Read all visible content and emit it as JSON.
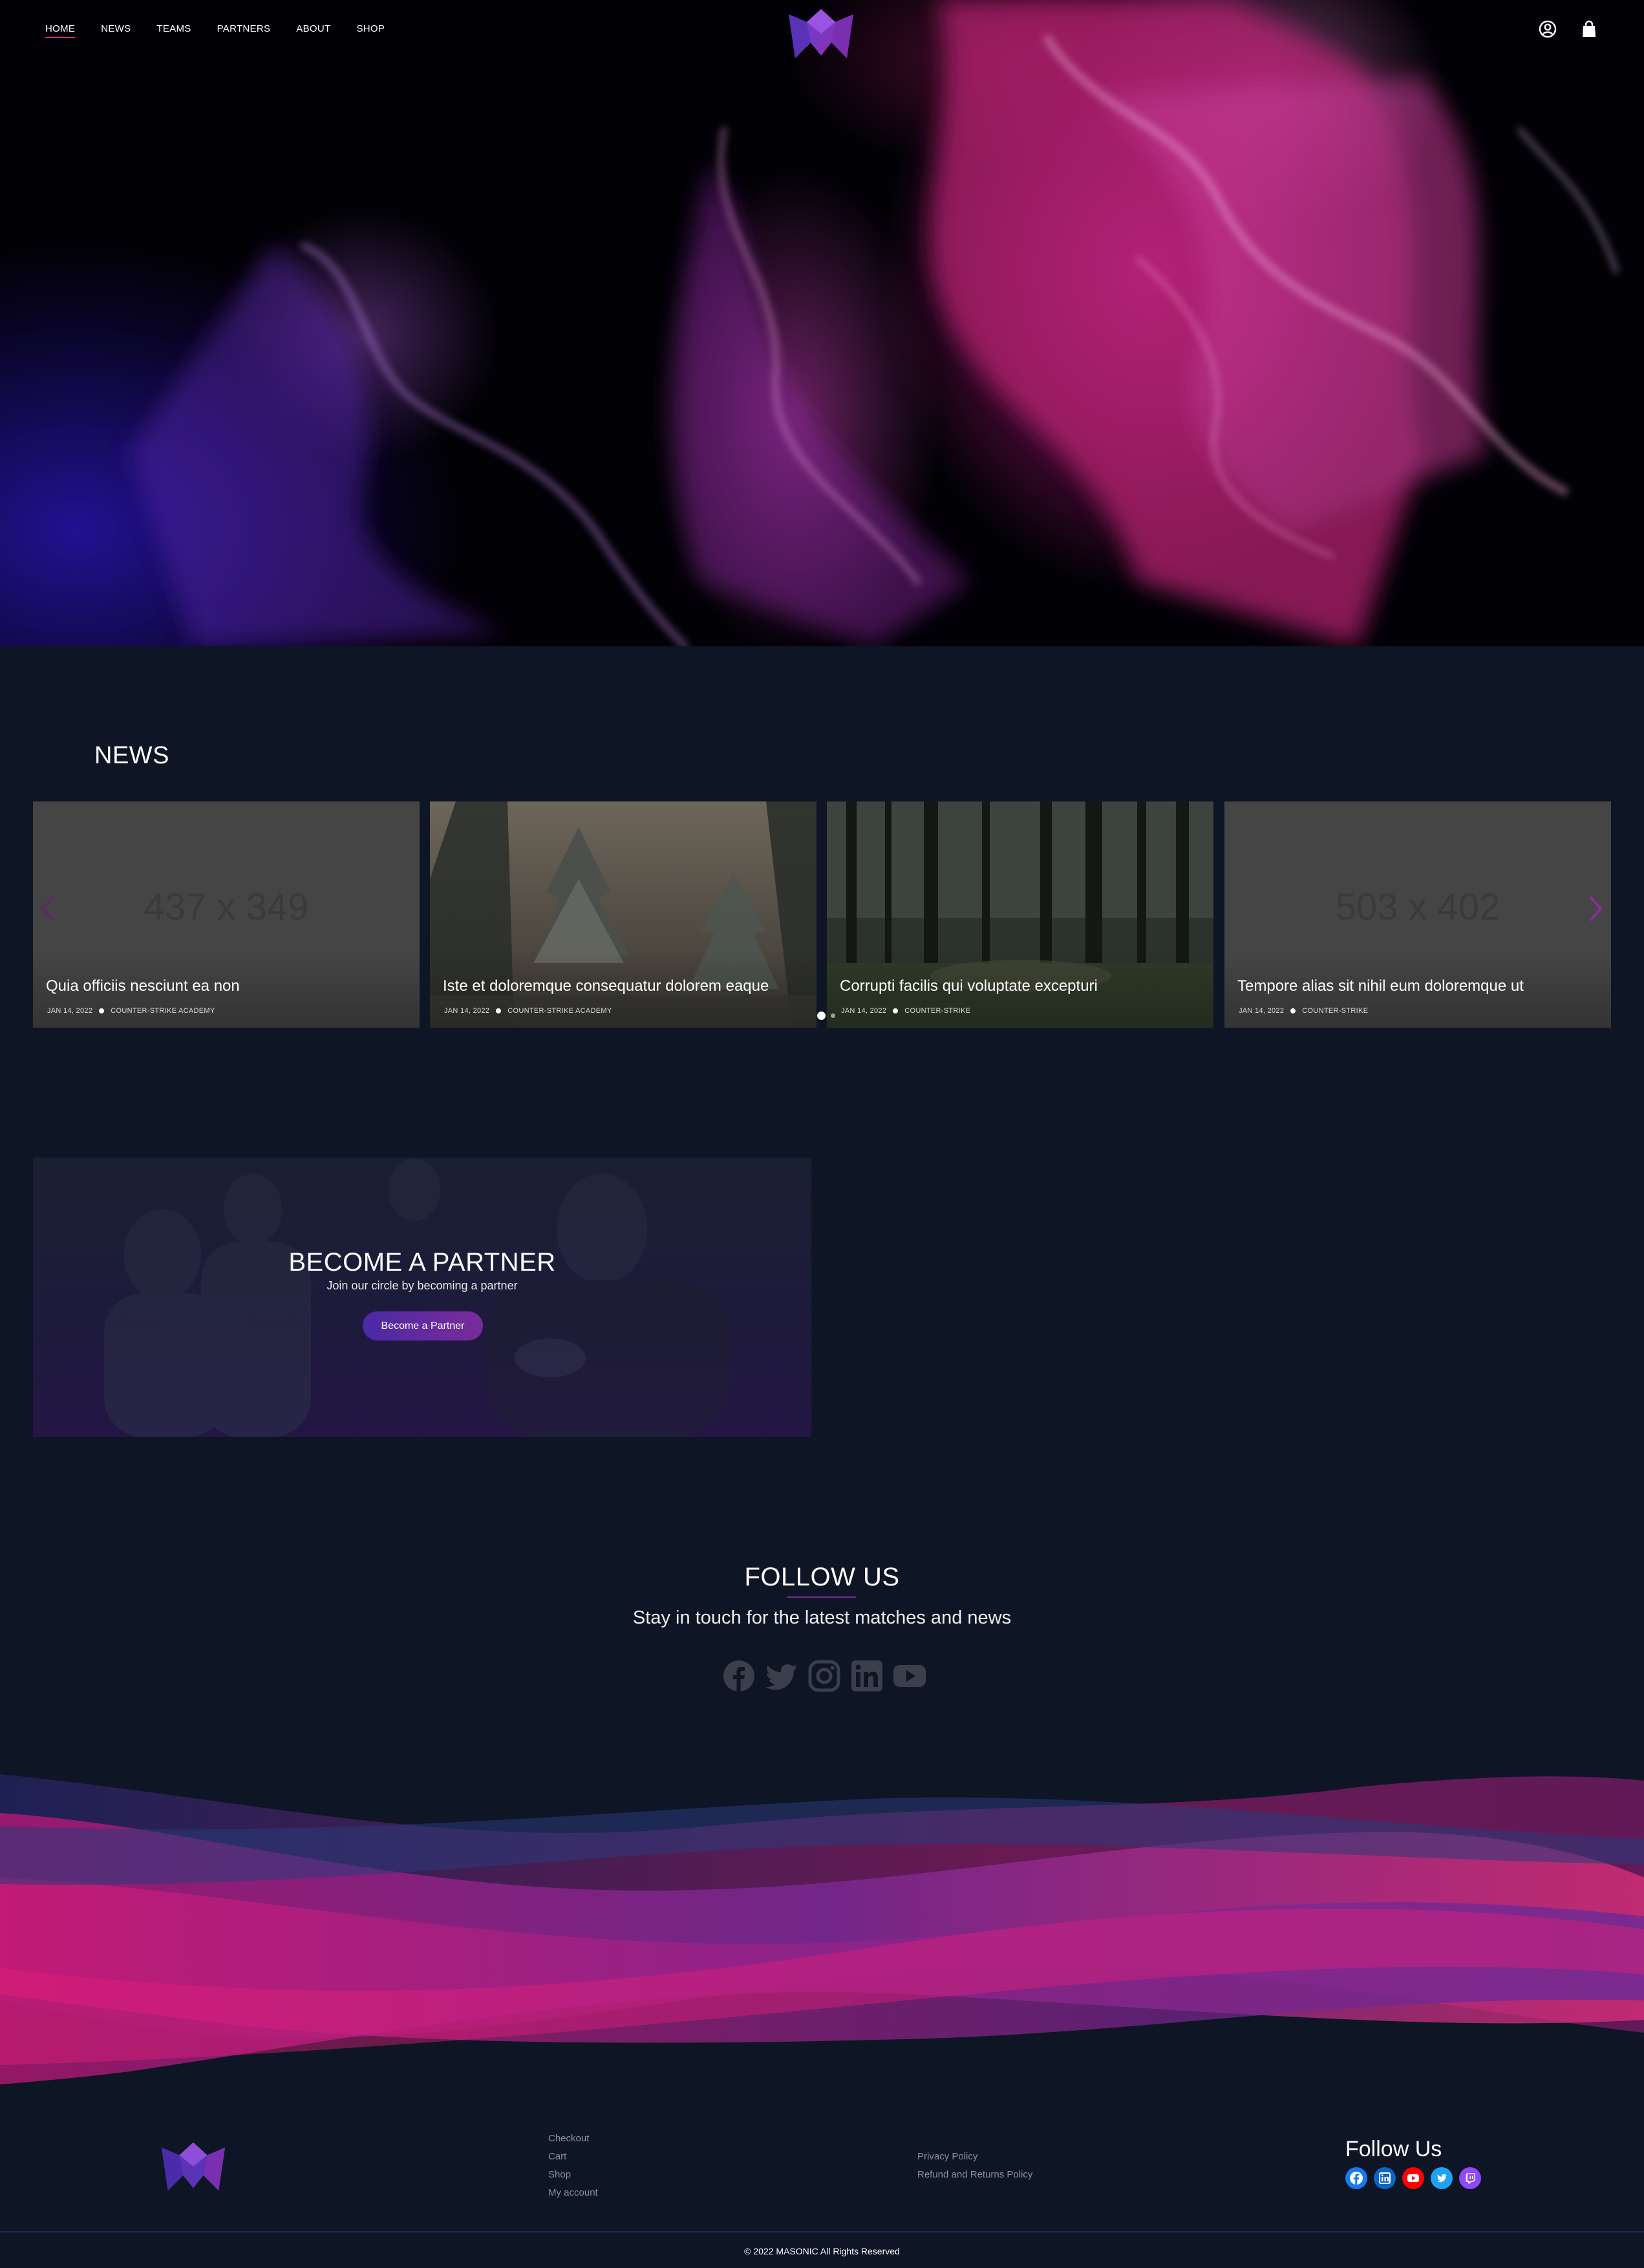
{
  "nav": {
    "items": [
      {
        "label": "HOME",
        "active": true
      },
      {
        "label": "NEWS"
      },
      {
        "label": "TEAMS"
      },
      {
        "label": "PARTNERS"
      },
      {
        "label": "ABOUT"
      },
      {
        "label": "SHOP"
      }
    ],
    "logo_icon": "masonic-crown-logo",
    "account_icon": "user-circle-icon",
    "cart_icon": "shopping-bag-icon"
  },
  "news": {
    "heading": "NEWS",
    "cards": [
      {
        "placeholder": "437 x 349",
        "title": "Quia officiis nesciunt ea non",
        "date": "JAN 14, 2022",
        "category": "COUNTER-STRIKE ACADEMY"
      },
      {
        "placeholder": "",
        "title": "Iste et doloremque consequatur dolorem eaque",
        "date": "JAN 14, 2022",
        "category": "COUNTER-STRIKE ACADEMY"
      },
      {
        "placeholder": "",
        "title": "Corrupti facilis qui voluptate excepturi",
        "date": "JAN 14, 2022",
        "category": "COUNTER-STRIKE"
      },
      {
        "placeholder": "503 x 402",
        "title": "Tempore alias sit nihil eum doloremque ut",
        "date": "JAN 14, 2022",
        "category": "COUNTER-STRIKE"
      }
    ],
    "prev_icon": "chevron-left-icon",
    "next_icon": "chevron-right-icon",
    "pager_active": 1,
    "pager_total": 2
  },
  "partner": {
    "title": "BECOME A PARTNER",
    "subtitle": "Join our circle by becoming a partner",
    "button_label": "Become a Partner"
  },
  "follow": {
    "title": "FOLLOW US",
    "subtitle": "Stay in touch for the latest matches and news",
    "icons": [
      "facebook-icon",
      "twitter-icon",
      "instagram-icon",
      "linkedin-icon",
      "youtube-icon"
    ]
  },
  "footer": {
    "links_col1": [
      "Checkout",
      "Cart",
      "Shop",
      "My account"
    ],
    "links_col2": [
      "Privacy Policy",
      "Refund and Returns Policy"
    ],
    "follow_title": "Follow Us",
    "social": [
      {
        "icon": "facebook-icon",
        "color": "#1877f2"
      },
      {
        "icon": "linkedin-icon",
        "color": "#0a66c2"
      },
      {
        "icon": "youtube-icon",
        "color": "#ff0000"
      },
      {
        "icon": "twitter-icon",
        "color": "#1da1f2"
      },
      {
        "icon": "twitch-icon",
        "color": "#9146ff"
      }
    ],
    "copyright": "© 2022 MASONIC All Rights Reserved"
  },
  "colors": {
    "background": "#0e1525",
    "accent_pink": "#e6217d",
    "accent_purple": "#7a2b9a",
    "button_gradient_start": "#4a2aa6",
    "button_gradient_end": "#7b2b9a"
  }
}
